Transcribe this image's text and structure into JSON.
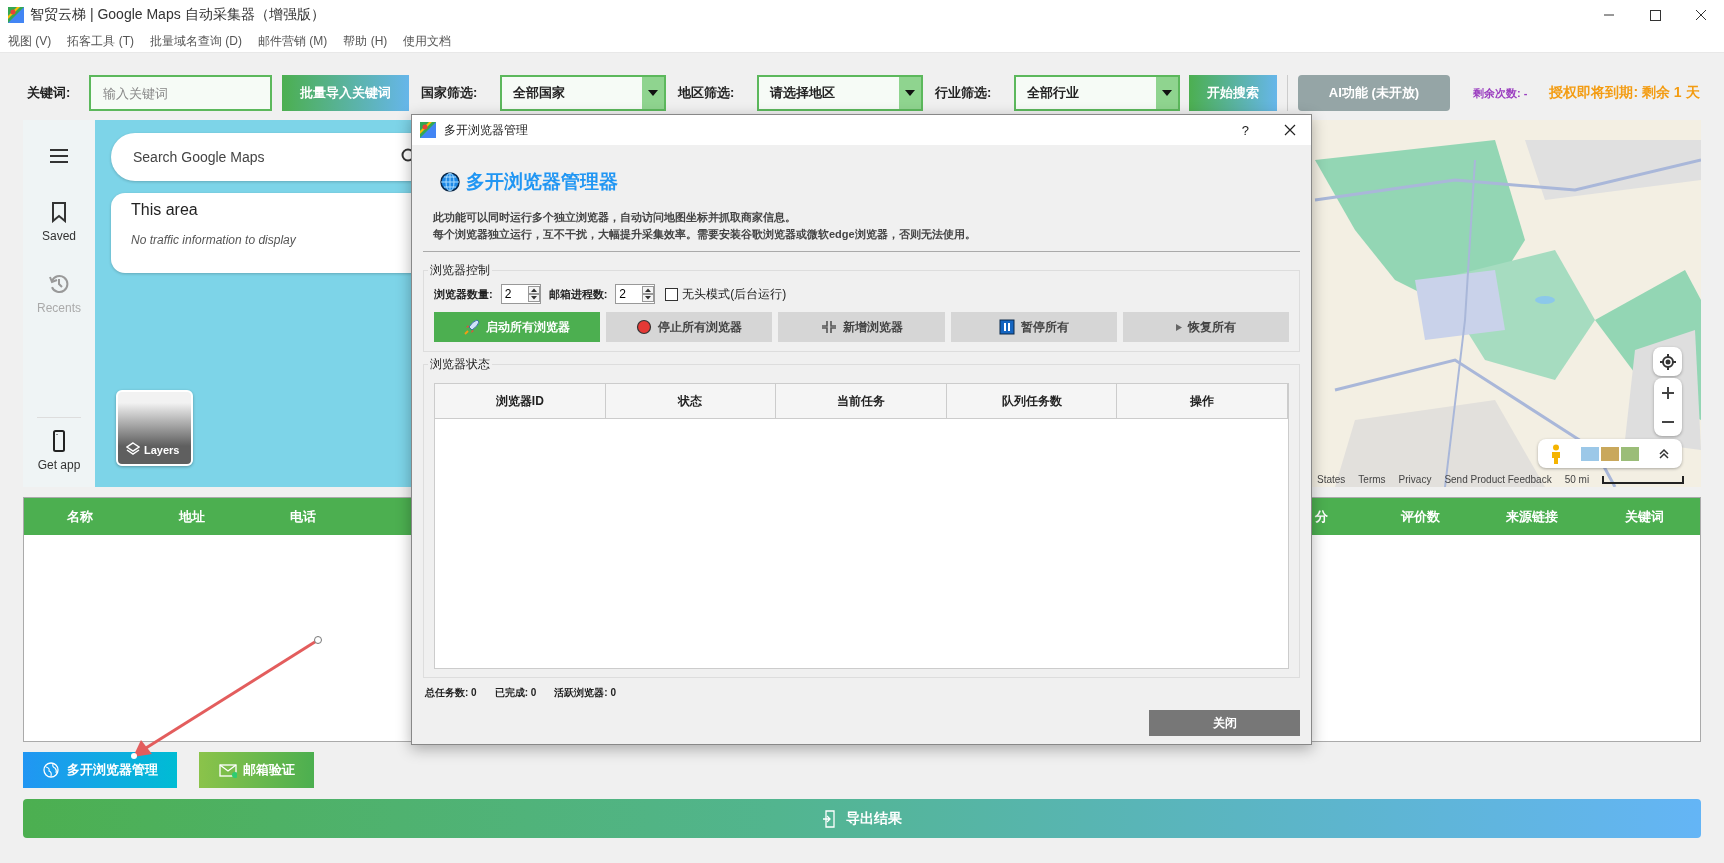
{
  "window": {
    "title": "智贸云梯 | Google Maps 自动采集器（增强版）"
  },
  "menu": [
    {
      "label": "视图 (V)"
    },
    {
      "label": "拓客工具 (T)"
    },
    {
      "label": "批量域名查询 (D)"
    },
    {
      "label": "邮件营销 (M)"
    },
    {
      "label": "帮助 (H)"
    },
    {
      "label": "使用文档"
    }
  ],
  "toolbar": {
    "keyword": {
      "label": "关键词:",
      "placeholder": "输入关键词"
    },
    "import_button": "批量导入关键词",
    "filters": [
      {
        "label": "国家筛选:",
        "value": "全部国家"
      },
      {
        "label": "地区筛选:",
        "value": "请选择地区"
      },
      {
        "label": "行业筛选:",
        "value": "全部行业"
      }
    ],
    "search_button": "开始搜索",
    "ai_button": {
      "label": "AI功能 (未开放)",
      "disabled": true
    },
    "remaining": "剩余次数: -",
    "license": "授权即将到期: 剩余 1 天"
  },
  "map": {
    "nav": [
      {
        "kind": "menu"
      },
      {
        "kind": "saved",
        "label": "Saved",
        "disabled": false
      },
      {
        "kind": "recents",
        "label": "Recents",
        "disabled": true
      },
      {
        "kind": "app",
        "label": "Get app",
        "disabled": false
      }
    ],
    "search": {
      "placeholder": "Search Google Maps"
    },
    "area_card": {
      "title": "This area",
      "message": "No traffic information to display"
    },
    "layers": "Layers",
    "attribution": [
      "States",
      "Terms",
      "Privacy",
      "Send Product Feedback"
    ],
    "scale": "50 mi"
  },
  "results_table": {
    "columns_left": [
      "名称",
      "地址",
      "电话"
    ],
    "columns_right": [
      "分",
      "评价数",
      "来源链接",
      "关键词"
    ]
  },
  "bottom": {
    "buttons": [
      {
        "kind": "browsers",
        "label": "多开浏览器管理"
      },
      {
        "kind": "email",
        "label": "邮箱验证"
      }
    ],
    "export_button": "导出结果"
  },
  "dialog": {
    "title": "多开浏览器管理",
    "help": "?",
    "heading": "多开浏览器管理器",
    "description": [
      "此功能可以同时运行多个独立浏览器，自动访问地图坐标并抓取商家信息。",
      "每个浏览器独立运行，互不干扰，大幅提升采集效率。需要安装谷歌浏览器或微软edge浏览器，否则无法使用。"
    ],
    "controls": {
      "title": "浏览器控制",
      "spinners": [
        {
          "label": "浏览器数量:",
          "value": "2"
        },
        {
          "label": "邮箱进程数:",
          "value": "2"
        }
      ],
      "headless": {
        "label": "无头模式(后台运行)",
        "checked": false
      },
      "buttons": [
        {
          "kind": "start",
          "label": "启动所有浏览器"
        },
        {
          "kind": "stop",
          "label": "停止所有浏览器"
        },
        {
          "kind": "add",
          "label": "新增浏览器"
        },
        {
          "kind": "pause",
          "label": "暂停所有"
        },
        {
          "kind": "resume",
          "label": "恢复所有"
        }
      ]
    },
    "status": {
      "title": "浏览器状态",
      "columns": [
        "浏览器ID",
        "状态",
        "当前任务",
        "队列任务数",
        "操作"
      ]
    },
    "stats": [
      "总任务数: 0",
      "已完成: 0",
      "活跃浏览器: 0"
    ],
    "close_button": "关闭"
  }
}
